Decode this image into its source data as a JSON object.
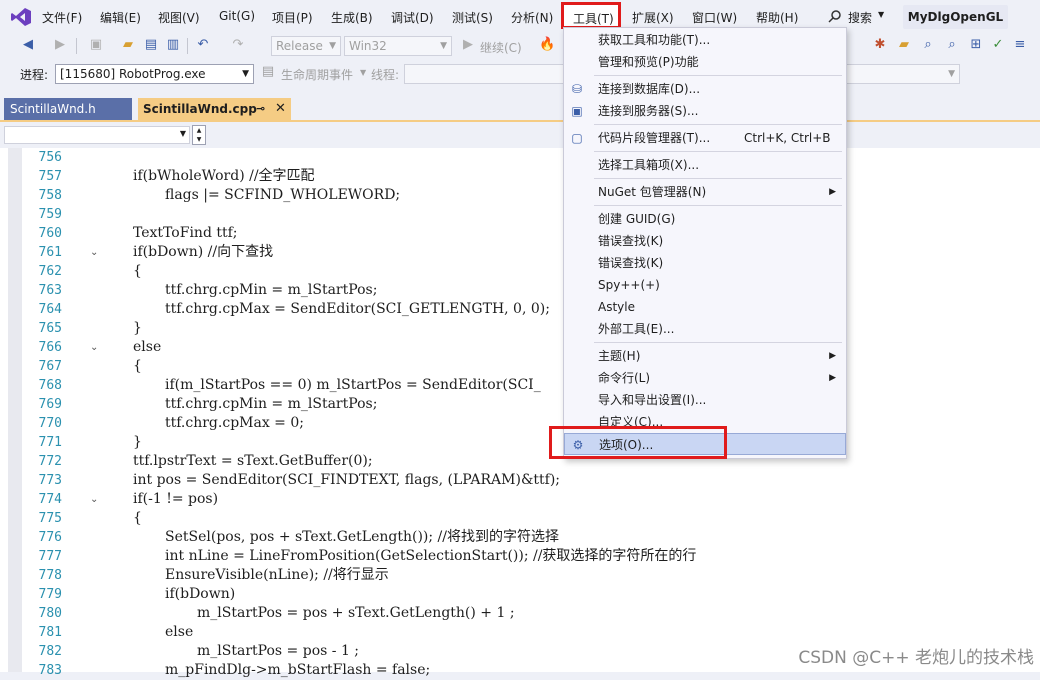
{
  "menubar": {
    "items": [
      "文件(F)",
      "编辑(E)",
      "视图(V)",
      "Git(G)",
      "项目(P)",
      "生成(B)",
      "调试(D)",
      "测试(S)",
      "分析(N)",
      "工具(T)",
      "扩展(X)",
      "窗口(W)",
      "帮助(H)"
    ],
    "search_label": "搜索",
    "project_title": "MyDlgOpenGL"
  },
  "toolbar": {
    "config": "Release",
    "platform": "Win32",
    "continue": "继续(C)",
    "process_label": "进程:",
    "process_value": "[115680] RobotProg.exe",
    "lifecycle": "生命周期事件",
    "thread_label": "线程:"
  },
  "tabs": {
    "inactive": "ScintillaWnd.h",
    "active": "ScintillaWnd.cpp",
    "pin_icon": "pin-icon",
    "close_icon": "close-icon"
  },
  "code_lines": [
    {
      "n": "756",
      "t": "",
      "ind": 0
    },
    {
      "n": "757",
      "t": "if(bWholeWord) //全字匹配",
      "ind": 0
    },
    {
      "n": "758",
      "t": "flags |= SCFIND_WHOLEWORD;",
      "ind": 1
    },
    {
      "n": "759",
      "t": "",
      "ind": 0
    },
    {
      "n": "760",
      "t": "TextToFind ttf;",
      "ind": 0
    },
    {
      "n": "761",
      "t": "if(bDown) //向下查找",
      "ind": 0,
      "fold": true
    },
    {
      "n": "762",
      "t": "{",
      "ind": 0
    },
    {
      "n": "763",
      "t": "ttf.chrg.cpMin = m_lStartPos;",
      "ind": 1
    },
    {
      "n": "764",
      "t": "ttf.chrg.cpMax = SendEditor(SCI_GETLENGTH, 0, 0);",
      "ind": 1
    },
    {
      "n": "765",
      "t": "}",
      "ind": 0
    },
    {
      "n": "766",
      "t": "else",
      "ind": 0,
      "fold": true
    },
    {
      "n": "767",
      "t": "{",
      "ind": 0
    },
    {
      "n": "768",
      "t": "if(m_lStartPos == 0) m_lStartPos = SendEditor(SCI_",
      "ind": 1
    },
    {
      "n": "769",
      "t": "ttf.chrg.cpMin = m_lStartPos;",
      "ind": 1
    },
    {
      "n": "770",
      "t": "ttf.chrg.cpMax = 0;",
      "ind": 1
    },
    {
      "n": "771",
      "t": "}",
      "ind": 0
    },
    {
      "n": "772",
      "t": "ttf.lpstrText = sText.GetBuffer(0);",
      "ind": 0
    },
    {
      "n": "773",
      "t": "int pos = SendEditor(SCI_FINDTEXT, flags, (LPARAM)&ttf);",
      "ind": 0
    },
    {
      "n": "774",
      "t": "if(-1 != pos)",
      "ind": 0,
      "fold": true
    },
    {
      "n": "775",
      "t": "{",
      "ind": 0
    },
    {
      "n": "776",
      "t": "SetSel(pos, pos + sText.GetLength()); //将找到的字符选择",
      "ind": 1
    },
    {
      "n": "777",
      "t": "int nLine = LineFromPosition(GetSelectionStart()); //获取选择的字符所在的行",
      "ind": 1
    },
    {
      "n": "778",
      "t": "EnsureVisible(nLine); //将行显示",
      "ind": 1
    },
    {
      "n": "779",
      "t": "if(bDown)",
      "ind": 1
    },
    {
      "n": "780",
      "t": "m_lStartPos = pos + sText.GetLength() + 1 ;",
      "ind": 2
    },
    {
      "n": "781",
      "t": "else",
      "ind": 1
    },
    {
      "n": "782",
      "t": "m_lStartPos = pos - 1 ;",
      "ind": 2
    },
    {
      "n": "783",
      "t": "m_pFindDlg->m_bStartFlash = false;",
      "ind": 1
    }
  ],
  "tools_menu": {
    "items": [
      {
        "label": "获取工具和功能(T)...",
        "icon": ""
      },
      {
        "label": "管理和预览(P)功能",
        "icon": ""
      },
      {
        "label": "连接到数据库(D)...",
        "icon": "database-icon"
      },
      {
        "label": "连接到服务器(S)...",
        "icon": "server-icon"
      },
      {
        "label": "代码片段管理器(T)...",
        "icon": "snippet-icon",
        "shortcut": "Ctrl+K, Ctrl+B"
      },
      {
        "label": "选择工具箱项(X)...",
        "icon": ""
      },
      {
        "label": "NuGet 包管理器(N)",
        "icon": "",
        "submenu": true
      },
      {
        "label": "创建 GUID(G)",
        "icon": ""
      },
      {
        "label": "错误查找(K)",
        "icon": ""
      },
      {
        "label": "错误查找(K)",
        "icon": ""
      },
      {
        "label": "Spy++(+)",
        "icon": ""
      },
      {
        "label": "Astyle",
        "icon": ""
      },
      {
        "label": "外部工具(E)...",
        "icon": ""
      },
      {
        "label": "主题(H)",
        "icon": "",
        "submenu": true
      },
      {
        "label": "命令行(L)",
        "icon": "",
        "submenu": true
      },
      {
        "label": "导入和导出设置(I)...",
        "icon": ""
      },
      {
        "label": "自定义(C)...",
        "icon": ""
      },
      {
        "label": "选项(O)...",
        "icon": "gear-icon"
      }
    ]
  },
  "watermark": "CSDN @C++ 老炮儿的技术栈"
}
